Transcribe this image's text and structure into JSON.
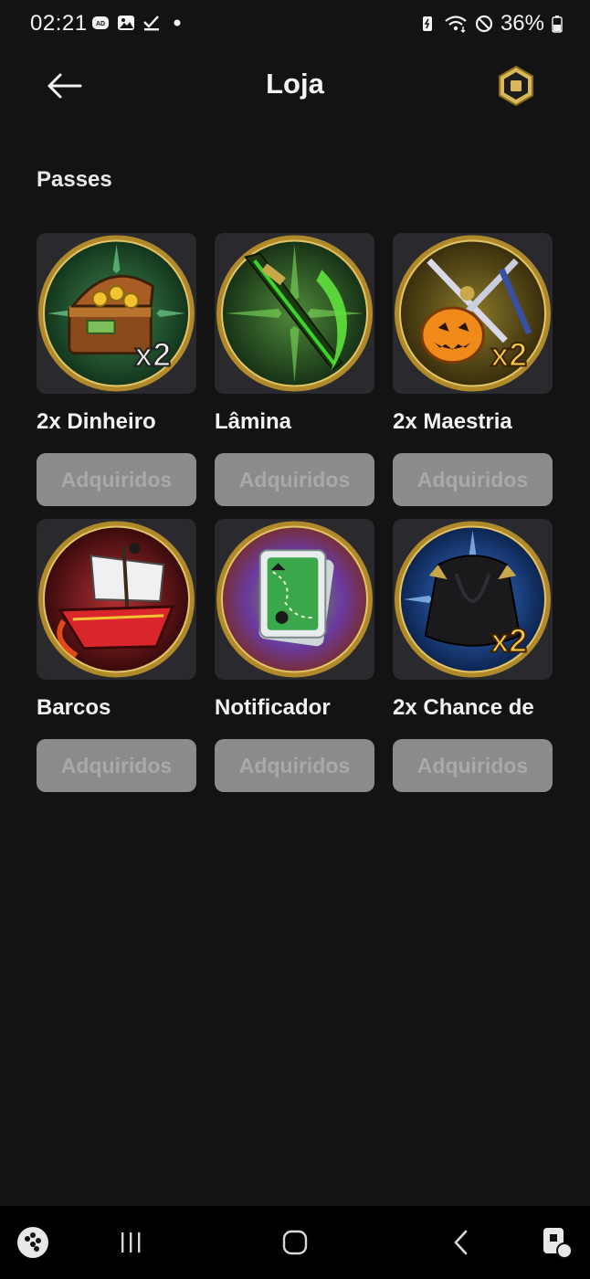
{
  "status_bar": {
    "time": "02:21",
    "battery_percent": "36%",
    "left_icons": [
      "ad-blocker-icon",
      "gallery-icon",
      "check-download-icon",
      "dot-icon"
    ],
    "right_icons": [
      "battery-saver-icon",
      "wifi-icon",
      "do-not-disturb-icon",
      "battery-icon"
    ]
  },
  "header": {
    "title": "Loja",
    "back_icon": "arrow-left-icon",
    "currency_icon": "robux-icon"
  },
  "section": {
    "title": "Passes"
  },
  "passes": [
    {
      "name": "2x Dinheiro",
      "button": "Adquiridos",
      "icon": "treasure-chest-x2-icon",
      "ring": "#2e6b3e"
    },
    {
      "name": "Lâmina",
      "button": "Adquiridos",
      "icon": "green-blade-icon",
      "ring": "#2f5c2a"
    },
    {
      "name": "2x Maestria",
      "button": "Adquiridos",
      "icon": "crossed-swords-pumpkin-x2-icon",
      "ring": "#6b5a1e"
    },
    {
      "name": "Barcos",
      "button": "Adquiridos",
      "icon": "pirate-ship-icon",
      "ring": "#7a1f22"
    },
    {
      "name": "Notificador",
      "button": "Adquiridos",
      "icon": "map-card-icon",
      "ring": "#3f6a2a"
    },
    {
      "name": "2x Chance de",
      "button": "Adquiridos",
      "icon": "black-cape-x2-icon",
      "ring": "#1f4fa0"
    }
  ],
  "nav_bar": {
    "items": [
      "game-launcher-icon",
      "recent-apps-icon",
      "home-icon",
      "back-icon",
      "assistant-icon"
    ]
  },
  "colors": {
    "background": "#131314",
    "card": "#2a2a2e",
    "button": "#8b8b8e",
    "button_text": "#a9a9ab",
    "gold": "#c9a84a"
  }
}
